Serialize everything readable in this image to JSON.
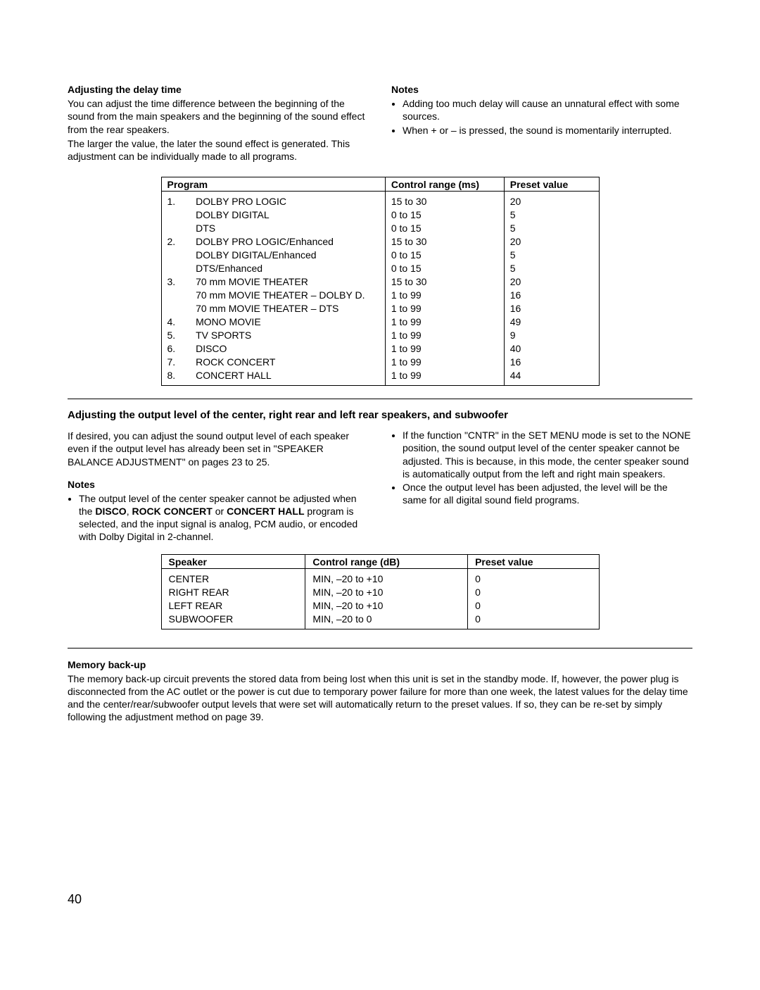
{
  "section1": {
    "heading": "Adjusting the delay time",
    "para1": "You can adjust the time difference between the beginning of the sound from the main speakers and the beginning of the sound effect from the rear speakers.",
    "para2": "The larger the value, the later the sound effect is generated. This adjustment can be individually made to all programs.",
    "notes_hdr": "Notes",
    "notes": [
      "Adding too much delay will cause an unnatural effect with some sources.",
      "When + or – is pressed, the sound is momentarily interrupted."
    ],
    "table": {
      "headers": {
        "program": "Program",
        "range": "Control range (ms)",
        "preset": "Preset value"
      },
      "rows": [
        {
          "num": "1.",
          "prog": "DOLBY PRO LOGIC",
          "range": "15 to 30",
          "preset": "20"
        },
        {
          "num": "",
          "prog": "DOLBY DIGITAL",
          "range": "0 to 15",
          "preset": "5"
        },
        {
          "num": "",
          "prog": "DTS",
          "range": "0 to 15",
          "preset": "5"
        },
        {
          "num": "2.",
          "prog": "DOLBY PRO LOGIC/Enhanced",
          "range": "15 to 30",
          "preset": "20"
        },
        {
          "num": "",
          "prog": "DOLBY DIGITAL/Enhanced",
          "range": "0 to 15",
          "preset": "5"
        },
        {
          "num": "",
          "prog": "DTS/Enhanced",
          "range": "0 to 15",
          "preset": "5"
        },
        {
          "num": "3.",
          "prog": "70 mm MOVIE THEATER",
          "range": "15 to 30",
          "preset": "20"
        },
        {
          "num": "",
          "prog": "70 mm MOVIE THEATER – DOLBY D.",
          "range": "1 to 99",
          "preset": "16"
        },
        {
          "num": "",
          "prog": "70 mm MOVIE THEATER – DTS",
          "range": "1 to 99",
          "preset": "16"
        },
        {
          "num": "4.",
          "prog": "MONO MOVIE",
          "range": "1 to 99",
          "preset": "49"
        },
        {
          "num": "5.",
          "prog": "TV SPORTS",
          "range": "1 to 99",
          "preset": "9"
        },
        {
          "num": "6.",
          "prog": "DISCO",
          "range": "1 to 99",
          "preset": "40"
        },
        {
          "num": "7.",
          "prog": "ROCK CONCERT",
          "range": "1 to 99",
          "preset": "16"
        },
        {
          "num": "8.",
          "prog": "CONCERT HALL",
          "range": "1 to 99",
          "preset": "44"
        }
      ]
    }
  },
  "section2": {
    "heading": "Adjusting the output level of the center, right rear and left rear speakers, and subwoofer",
    "para1": "If desired, you can adjust the sound output level of each speaker even if the output level has already been set in \"SPEAKER BALANCE ADJUSTMENT\" on pages 23 to 25.",
    "notes_hdr": "Notes",
    "note_left_pre": "The output level of the center speaker cannot be adjusted when the ",
    "note_left_b1": "DISCO",
    "note_left_mid1": ", ",
    "note_left_b2": "ROCK CONCERT",
    "note_left_mid2": " or ",
    "note_left_b3": "CONCERT HALL",
    "note_left_post": " program is selected, and the input signal is analog, PCM audio, or encoded with Dolby Digital in 2-channel.",
    "notes_right": [
      "If the function \"CNTR\" in the SET MENU mode is set to the NONE position, the sound output level of the center speaker cannot be adjusted.  This is because, in this mode, the center speaker sound is automatically output from the left and right main speakers.",
      "Once the output level has been adjusted, the level will be the same for all digital sound field programs."
    ],
    "table": {
      "headers": {
        "speaker": "Speaker",
        "range": "Control range (dB)",
        "preset": "Preset value"
      },
      "rows": [
        {
          "spk": "CENTER",
          "range": "MIN, –20 to +10",
          "preset": "0"
        },
        {
          "spk": "RIGHT REAR",
          "range": "MIN, –20 to +10",
          "preset": "0"
        },
        {
          "spk": "LEFT REAR",
          "range": "MIN, –20 to +10",
          "preset": "0"
        },
        {
          "spk": "SUBWOOFER",
          "range": "MIN, –20 to 0",
          "preset": "0"
        }
      ]
    }
  },
  "section3": {
    "heading": "Memory back-up",
    "body": "The memory back-up circuit prevents the stored data from being lost when this unit is set in the standby mode.  If, however, the power plug is disconnected from the AC outlet or the power is cut due to temporary power failure for more than one week, the latest values for the delay time and the center/rear/subwoofer output levels that were set will automatically return to the preset values.  If so, they can be re-set by simply following the adjustment method on page 39."
  },
  "page_number": "40"
}
